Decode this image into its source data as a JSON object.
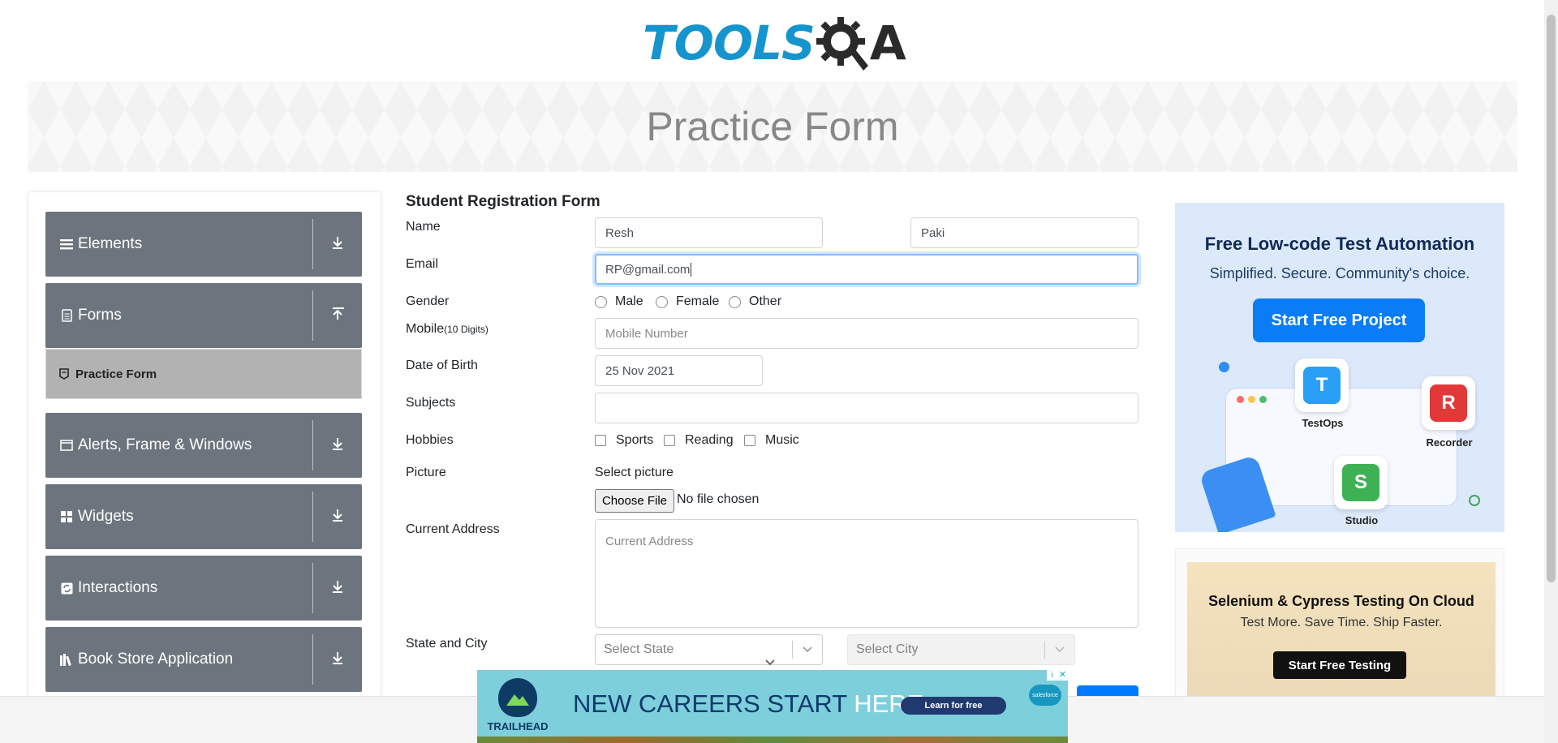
{
  "header": {
    "logo_tools": "TOOLS",
    "logo_qa": "A",
    "page_title": "Practice Form"
  },
  "sidebar": {
    "groups": [
      {
        "label": "Elements",
        "icon": "hamburger-icon"
      },
      {
        "label": "Forms",
        "icon": "document-icon",
        "expanded": true
      },
      {
        "label": "Alerts, Frame & Windows",
        "icon": "window-icon"
      },
      {
        "label": "Widgets",
        "icon": "grid-icon"
      },
      {
        "label": "Interactions",
        "icon": "refresh-icon"
      },
      {
        "label": "Book Store Application",
        "icon": "books-icon"
      }
    ],
    "sub_item": {
      "label": "Practice Form",
      "icon": "form-icon"
    }
  },
  "form": {
    "title": "Student Registration Form",
    "name_label": "Name",
    "first_name": "Resh",
    "last_name": "Paki",
    "email_label": "Email",
    "email_value": "RP@gmail.com",
    "gender_label": "Gender",
    "gender_options": [
      "Male",
      "Female",
      "Other"
    ],
    "mobile_label": "Mobile",
    "mobile_hint": "(10 Digits)",
    "mobile_placeholder": "Mobile Number",
    "dob_label": "Date of Birth",
    "dob_value": "25 Nov 2021",
    "subjects_label": "Subjects",
    "hobbies_label": "Hobbies",
    "hobbies": [
      "Sports",
      "Reading",
      "Music"
    ],
    "picture_label": "Picture",
    "select_picture": "Select picture",
    "choose_file": "Choose File",
    "no_file": "No file chosen",
    "address_label": "Current Address",
    "address_placeholder": "Current Address",
    "state_city_label": "State and City",
    "state_placeholder": "Select State",
    "city_placeholder": "Select City"
  },
  "ads": {
    "right_ad_title": "Free Low-code Test Automation",
    "right_ad_subtitle": "Simplified. Secure. Community's choice.",
    "right_ad_button": "Start Free Project",
    "right_ad_labels": [
      "TestOps",
      "Recorder",
      "Studio"
    ],
    "right_ad2_title": "Selenium & Cypress Testing On Cloud",
    "right_ad2_subtitle": "Test More. Save Time. Ship Faster.",
    "right_ad2_button": "Start Free Testing",
    "bottom_ad_text_1": "NEW CAREERS START ",
    "bottom_ad_text_2": "HERE.",
    "bottom_ad_learn": "Learn for free",
    "bottom_ad_brand": "TRAILHEAD",
    "bottom_ad_partner": "salesforce"
  },
  "colors": {
    "brand_blue": "#1594ce",
    "sidebar_bg": "#6c757d",
    "active_item_bg": "#b2b2b2",
    "focus_border": "#80bdff"
  }
}
